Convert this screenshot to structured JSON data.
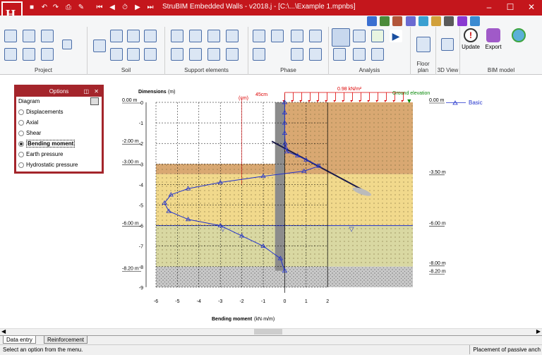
{
  "window": {
    "title": "StruBIM Embedded Walls - v2018.j - [C:\\...\\Example 1.mpnbs]",
    "logo": "H",
    "controls": [
      "minimize-icon",
      "maximize-icon",
      "close-icon"
    ]
  },
  "ribbon": {
    "groups": [
      {
        "id": "project",
        "label": "Project"
      },
      {
        "id": "soil",
        "label": "Soil"
      },
      {
        "id": "support",
        "label": "Support elements"
      },
      {
        "id": "phase",
        "label": "Phase"
      },
      {
        "id": "analysis",
        "label": "Analysis"
      },
      {
        "id": "floorplan",
        "label": "Floor plan"
      },
      {
        "id": "view3d",
        "label": "3D View"
      },
      {
        "id": "bim",
        "label": "BIM model"
      }
    ],
    "bim_buttons": {
      "update": "Update",
      "export": "Export"
    }
  },
  "options_panel": {
    "title": "Options",
    "section": "Diagram",
    "items": [
      {
        "label": "Displacements",
        "selected": false
      },
      {
        "label": "Axial",
        "selected": false
      },
      {
        "label": "Shear",
        "selected": false
      },
      {
        "label": "Bending moment",
        "selected": true
      },
      {
        "label": "Earth pressure",
        "selected": false
      },
      {
        "label": "Hydrostatic pressure",
        "selected": false
      }
    ]
  },
  "diagram": {
    "ylabel": "Dimensions",
    "ylabel_unit": "(m)",
    "xlabel": "Bending moment",
    "xlabel_unit": "(kN·m/m)",
    "load_label": "0.98 kN/m²",
    "ground_label": "Ground elevation",
    "cm_label": "(cm)",
    "width_label": "45cm",
    "legend_label": "Basic",
    "y_ticks": [
      "0",
      "-1",
      "-2",
      "-3",
      "-4",
      "-5",
      "-6",
      "-7",
      "-8",
      "-9"
    ],
    "x_ticks": [
      "-6",
      "-5",
      "-4",
      "-3",
      "-2",
      "-1",
      "0",
      "1",
      "2"
    ],
    "left_elevations": [
      "0.00 m",
      "-2.00 m",
      "-3.00 m",
      "-6.00 m",
      "-8.20 m"
    ],
    "right_elevations": [
      "0.00 m",
      "-3.50 m",
      "-6.00 m",
      "-8.00 m",
      "-8.20 m"
    ]
  },
  "chart_data": {
    "type": "line",
    "xlabel": "Bending moment (kN·m/m)",
    "ylabel": "Dimensions (m)",
    "xlim": [
      -6,
      2
    ],
    "ylim": [
      -9,
      0
    ],
    "series": [
      {
        "name": "Basic",
        "x": [
          0,
          0,
          0,
          0,
          0.02,
          0.05,
          0.1,
          0.6,
          1.0,
          1.6,
          0.9,
          -1.0,
          -3.0,
          -4.5,
          -5.3,
          -5.6,
          -5.4,
          -4.5,
          -3.0,
          -2.0,
          -1.0,
          -0.2,
          0
        ],
        "y": [
          0,
          -0.5,
          -1.0,
          -1.5,
          -2.0,
          -2.2,
          -2.4,
          -2.6,
          -2.8,
          -3.1,
          -3.35,
          -3.6,
          -3.9,
          -4.2,
          -4.5,
          -4.9,
          -5.3,
          -5.7,
          -6.0,
          -6.5,
          -7.0,
          -7.6,
          -8.2
        ]
      }
    ],
    "soil_layers_m": [
      [
        -3.0,
        -3.5
      ],
      [
        -3.5,
        -6.0
      ],
      [
        -6.0,
        -8.0
      ],
      [
        -8.0,
        -9.0
      ]
    ],
    "water_level_m": -6.0
  },
  "tabs": [
    "Data entry",
    "Reinforcement"
  ],
  "status": {
    "left": "Select an option from the menu.",
    "right": "Placement of passive anch"
  }
}
